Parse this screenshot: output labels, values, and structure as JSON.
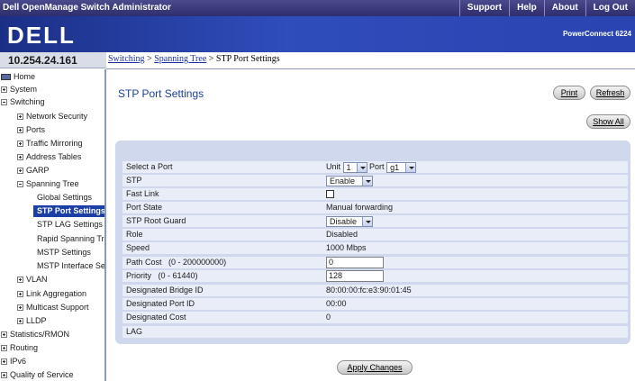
{
  "app_title": "Dell OpenManage Switch Administrator",
  "top_menu": [
    "Support",
    "Help",
    "About",
    "Log Out"
  ],
  "brand": {
    "logo": "DELL",
    "product": "PowerConnect 6224"
  },
  "ip_address": "10.254.24.161",
  "breadcrumb": {
    "item1": "Switching",
    "sep1": " > ",
    "item2": "Spanning Tree",
    "sep2": " > ",
    "current": "STP Port Settings"
  },
  "nav": {
    "home": "Home",
    "system": "System",
    "switching": "Switching",
    "network_security": "Network Security",
    "ports": "Ports",
    "traffic_mirroring": "Traffic Mirroring",
    "address_tables": "Address Tables",
    "garp": "GARP",
    "spanning_tree": "Spanning Tree",
    "global_settings": "Global Settings",
    "stp_port_settings": "STP Port Settings",
    "stp_lag_settings": "STP LAG Settings",
    "rapid_spanning_tree": "Rapid Spanning Tre",
    "mstp_settings": "MSTP Settings",
    "mstp_interface_settings": "MSTP Interface Set",
    "vlan": "VLAN",
    "link_aggregation": "Link Aggregation",
    "multicast_support": "Multicast Support",
    "lldp": "LLDP",
    "statistics_rmon": "Statistics/RMON",
    "routing": "Routing",
    "ipv6": "IPv6",
    "quality_of_service": "Quality of Service"
  },
  "page_title": "STP Port Settings",
  "buttons": {
    "print": "Print",
    "refresh": "Refresh",
    "show_all": "Show All",
    "apply": "Apply Changes"
  },
  "form": {
    "select_port": {
      "label": "Select a Port",
      "unit_label": "Unit",
      "unit_value": "1",
      "port_label": "Port",
      "port_value": "g1"
    },
    "stp": {
      "label": "STP",
      "value": "Enable"
    },
    "fast_link": {
      "label": "Fast Link",
      "checked": false
    },
    "port_state": {
      "label": "Port State",
      "value": "Manual forwarding"
    },
    "root_guard": {
      "label": "STP Root Guard",
      "value": "Disable"
    },
    "role": {
      "label": "Role",
      "value": "Disabled"
    },
    "speed": {
      "label": "Speed",
      "value": "1000 Mbps"
    },
    "path_cost": {
      "label": "Path Cost",
      "range": "(0 - 200000000)",
      "value": "0"
    },
    "priority": {
      "label": "Priority",
      "range": "(0 - 61440)",
      "value": "128"
    },
    "designated_bridge_id": {
      "label": "Designated Bridge ID",
      "value": "80:00:00:fc:e3:90:01:45"
    },
    "designated_port_id": {
      "label": "Designated Port ID",
      "value": "00:00"
    },
    "designated_cost": {
      "label": "Designated Cost",
      "value": "0"
    },
    "lag": {
      "label": "LAG",
      "value": ""
    }
  },
  "colors": {
    "title_blue": "#1c3f9c",
    "nav_selected": "#1c3fa6",
    "panel": "#d0d8ee",
    "row": "#e9edf8"
  }
}
